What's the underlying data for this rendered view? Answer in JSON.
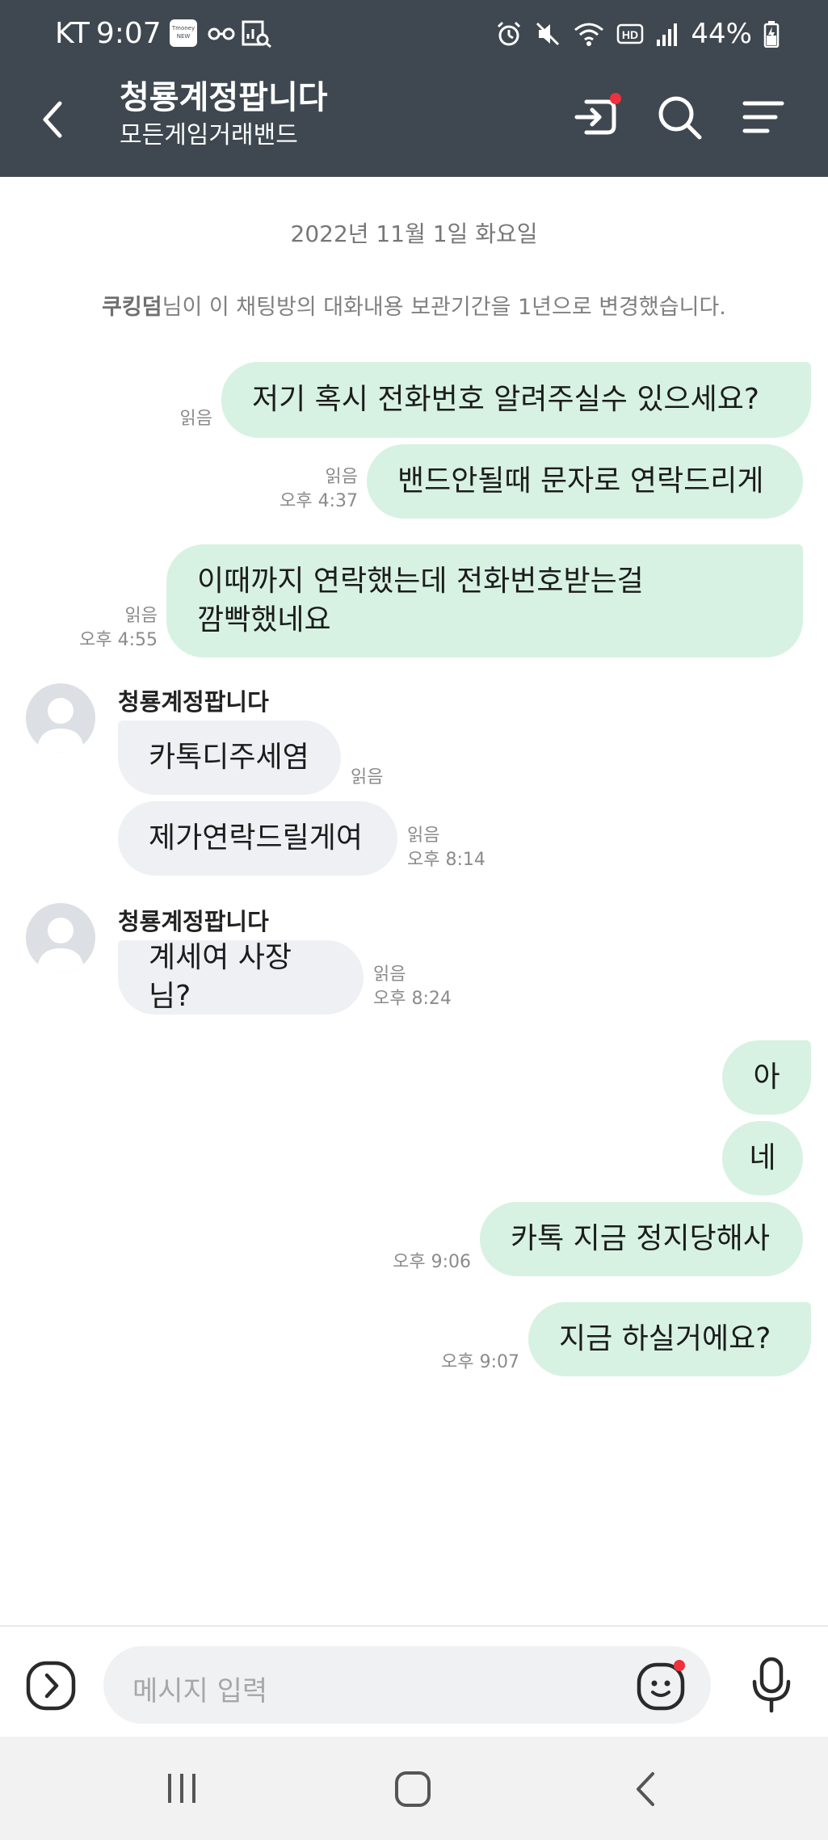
{
  "status": {
    "carrier": "KT",
    "time": "9:07",
    "app_badge": "Tmoney",
    "app_badge_sub": "NEW",
    "battery": "44%"
  },
  "header": {
    "title": "청룡계정팝니다",
    "subtitle": "모든게임거래밴드"
  },
  "chat": {
    "date": "2022년 11월 1일 화요일",
    "notice_user": "쿠킹덤",
    "notice_text": "님이 이 채팅방의 대화내용 보관기간을 1년으로 변경했습니다.",
    "messages": [
      {
        "text": "저기 혹시 전화번호 알려주실수 있으세요?",
        "read": "읽음",
        "time": ""
      },
      {
        "text": "밴드안될때 문자로 연락드리게",
        "read": "읽음",
        "time": "오후 4:37"
      },
      {
        "text1": "이때까지 연락했는데 전화번호받는걸",
        "text2": "깜빡했네요",
        "read": "읽음",
        "time": "오후 4:55"
      },
      {
        "sender": "청룡계정팝니다",
        "text": "카톡디주세염",
        "read": "읽음",
        "time": ""
      },
      {
        "text": "제가연락드릴게여",
        "read": "읽음",
        "time": "오후 8:14"
      },
      {
        "sender": "청룡계정팝니다",
        "text": "계세여 사장님?",
        "read": "읽음",
        "time": "오후 8:24"
      },
      {
        "text": "아"
      },
      {
        "text": "네"
      },
      {
        "text": "카톡 지금 정지당해사",
        "time": "오후 9:06"
      },
      {
        "text": "지금 하실거에요?",
        "time": "오후 9:07"
      }
    ]
  },
  "input": {
    "placeholder": "메시지 입력"
  },
  "colors": {
    "header_bg": "#3f4850",
    "my_bubble": "#d7f2e2",
    "other_bubble": "#eef0f3",
    "notification_dot": "#f0303c"
  }
}
